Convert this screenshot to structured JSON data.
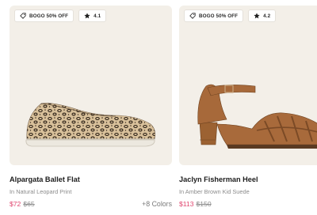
{
  "products": [
    {
      "promo": "BOGO 50% OFF",
      "rating": "4.1",
      "name": "Alpargata Ballet Flat",
      "color_name": "In Natural Leopard Print",
      "sale_price": "$72",
      "original_price": "$65",
      "colors": "+8 Colors"
    },
    {
      "promo": "BOGO 50% OFF",
      "rating": "4.2",
      "name": "Jaclyn Fisherman Heel",
      "color_name": "In Amber Brown Kid Suede",
      "sale_price": "$113",
      "original_price": "$150"
    }
  ],
  "theme": {
    "card_bg": "#f3efe8",
    "sale_color": "#e0456e",
    "muted_text": "#8b8b8b"
  }
}
